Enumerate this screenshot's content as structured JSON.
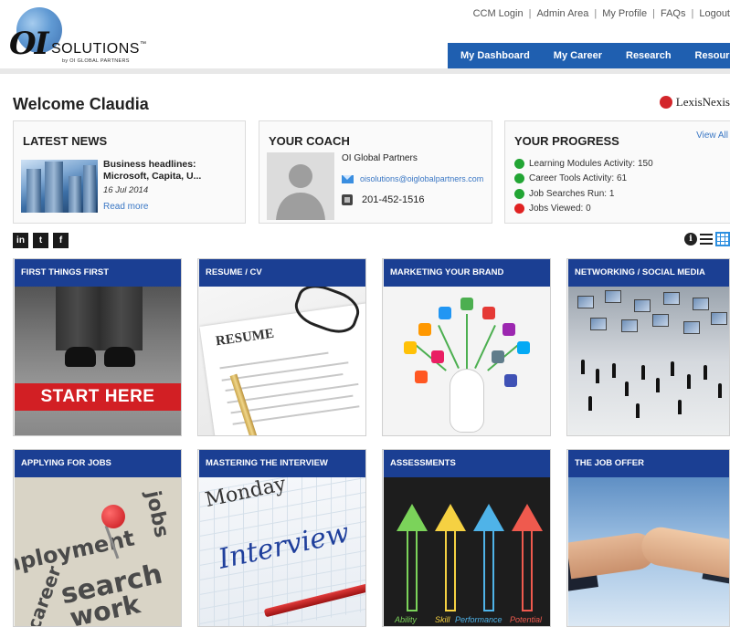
{
  "header": {
    "logo": {
      "brand_oi": "OI",
      "brand_solutions": "SOLUTIONS",
      "trademark": "™",
      "tagline": "by OI GLOBAL PARTNERS"
    },
    "top_links": [
      "CCM Login",
      "Admin Area",
      "My Profile",
      "FAQs",
      "Logout"
    ],
    "nav": [
      "My Dashboard",
      "My Career",
      "Research",
      "Resources"
    ],
    "nav_color": "#1f5fb0"
  },
  "welcome": "Welcome Claudia",
  "partner_logo": "LexisNexis",
  "latest_news": {
    "title": "LATEST NEWS",
    "headline": "Business headlines: Microsoft, Capita, U...",
    "date": "16 Jul 2014",
    "read_more": "Read more"
  },
  "coach": {
    "title": "YOUR COACH",
    "name": "OI Global Partners",
    "email": "oisolutions@oiglobalpartners.com",
    "phone": "201-452-1516"
  },
  "progress": {
    "title": "YOUR PROGRESS",
    "view_all": "View All",
    "items": [
      {
        "label": "Learning Modules Activity: 150",
        "status_color": "#22a534"
      },
      {
        "label": "Career Tools Activity: 61",
        "status_color": "#22a534"
      },
      {
        "label": "Job Searches Run: 1",
        "status_color": "#22a534"
      },
      {
        "label": "Jobs Viewed: 0",
        "status_color": "#e02222"
      }
    ]
  },
  "social": [
    {
      "icon": "linkedin-icon",
      "glyph": "in"
    },
    {
      "icon": "twitter-icon",
      "glyph": "t"
    },
    {
      "icon": "facebook-icon",
      "glyph": "f"
    }
  ],
  "view_toggle": {
    "info_glyph": "i",
    "active": "grid"
  },
  "tiles": [
    {
      "title": "FIRST THINGS FIRST",
      "image_text": "START HERE"
    },
    {
      "title": "RESUME / CV",
      "image_text": "RESUME"
    },
    {
      "title": "MARKETING YOUR BRAND"
    },
    {
      "title": "NETWORKING / SOCIAL MEDIA"
    },
    {
      "title": "APPLYING FOR JOBS",
      "image_words": [
        "mployment",
        "jobs",
        "search",
        "work",
        "career"
      ]
    },
    {
      "title": "MASTERING THE INTERVIEW",
      "image_words": [
        "Monday",
        "Interview"
      ]
    },
    {
      "title": "ASSESSMENTS",
      "image_words": [
        "Ability",
        "Skill",
        "Performance",
        "Potential"
      ]
    },
    {
      "title": "THE JOB OFFER"
    }
  ],
  "tile_header_color": "#1b3f93"
}
